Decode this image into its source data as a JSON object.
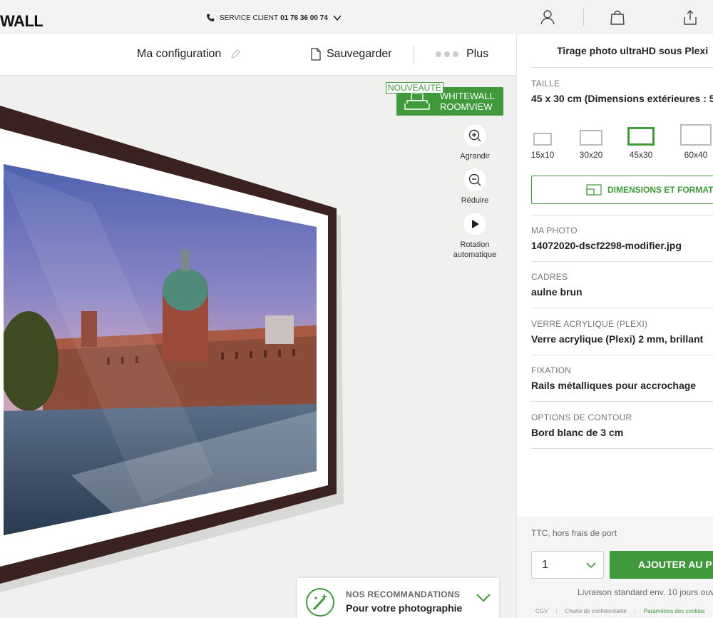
{
  "header": {
    "logo": "WALL",
    "service_label": "SERVICE CLIENT",
    "service_phone": "01 76 36 00 74"
  },
  "toolbar": {
    "config_label": "Ma configuration",
    "save_label": "Sauvegarder",
    "more_label": "Plus"
  },
  "canvas": {
    "badge_new": "NOUVEAUTÉ",
    "roomview_line1": "WHITEWALL",
    "roomview_line2": "ROOMVIEW",
    "zoom_in": "Agrandir",
    "zoom_out": "Réduire",
    "rotation_line1": "Rotation",
    "rotation_line2": "automatique",
    "reco_title": "NOS RECOMMANDATIONS",
    "reco_subtitle": "Pour votre photographie"
  },
  "panel": {
    "title": "Tirage photo ultraHD sous Plexi",
    "size_label": "TAILLE",
    "size_value": "45 x 30 cm (Dimensions extérieures : 5",
    "sizes": [
      "15x10",
      "30x20",
      "45x30",
      "60x40"
    ],
    "selected_size": "45x30",
    "dimensions_button": "DIMENSIONS ET FORMAT",
    "photo_label": "MA PHOTO",
    "photo_value": "14072020-dscf2298-modifier.jpg",
    "frame_label": "CADRES",
    "frame_value": "aulne brun",
    "glass_label": "VERRE ACRYLIQUE (PLEXI)",
    "glass_value": "Verre acrylique (Plexi) 2 mm, brillant",
    "mount_label": "FIXATION",
    "mount_value": "Rails métalliques pour accrochage",
    "edge_label": "OPTIONS DE CONTOUR",
    "edge_value": "Bord blanc de 3 cm"
  },
  "footer": {
    "ttc": "TTC, hors frais de port",
    "quantity": "1",
    "add_button": "AJOUTER AU P",
    "delivery": "Livraison standard  env. 10 jours ouv",
    "links": [
      "CGV",
      "Charte de confidentialité",
      "Paramètres des cookies"
    ]
  },
  "colors": {
    "accent": "#3e9a3b",
    "frame": "#3a2220"
  }
}
